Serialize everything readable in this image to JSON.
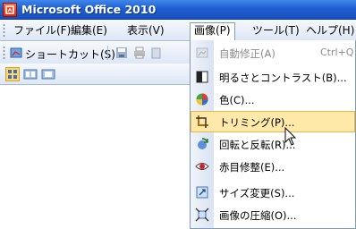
{
  "window": {
    "title": "Microsoft Office 2010"
  },
  "menu_bar": {
    "items": [
      {
        "label": "ファイル(F)"
      },
      {
        "label": "編集(E)"
      },
      {
        "label": "表示(V)"
      },
      {
        "label": "画像(P)",
        "open": true
      },
      {
        "label": "ツール(T)"
      },
      {
        "label": "ヘルプ(H)"
      }
    ]
  },
  "toolbar": {
    "shortcut_label": "ショートカット(S)..."
  },
  "image_menu": {
    "items": [
      {
        "label": "自動修正(A)",
        "shortcut": "Ctrl+Q",
        "icon": "auto-correct-icon",
        "disabled": true
      },
      {
        "label": "明るさとコントラスト(B)...",
        "icon": "brightness-contrast-icon"
      },
      {
        "label": "色(C)...",
        "icon": "color-icon"
      },
      {
        "label": "トリミング(P)...",
        "icon": "crop-icon",
        "highlighted": true
      },
      {
        "label": "回転と反転(R)...",
        "icon": "rotate-flip-icon"
      },
      {
        "label": "赤目修整(E)...",
        "icon": "red-eye-icon"
      },
      {
        "label": "サイズ変更(S)...",
        "icon": "resize-icon"
      },
      {
        "label": "画像の圧縮(O)...",
        "icon": "compress-icon"
      }
    ]
  },
  "colors": {
    "titlebar": "#1f5fd1",
    "highlight": "#ffe9a8",
    "highlight_border": "#e8b64a"
  }
}
